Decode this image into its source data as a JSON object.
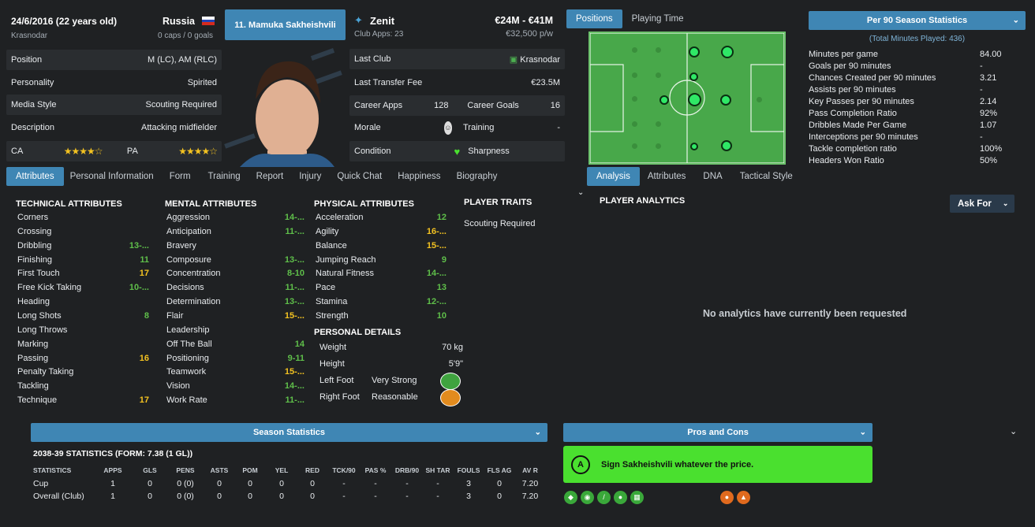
{
  "player": {
    "dob": "24/6/2016 (22 years old)",
    "club_city": "Krasnodar",
    "nation": "Russia",
    "caps": "0 caps / 0 goals",
    "name_badge": "11. Mamuka Sakheishvili",
    "club": "Zenit",
    "club_apps": "Club Apps: 23",
    "value": "€24M - €41M",
    "wage": "€32,500 p/w"
  },
  "info_rows": [
    {
      "label": "Position",
      "value": "M (LC), AM (RLC)"
    },
    {
      "label": "Personality",
      "value": "Spirited"
    },
    {
      "label": "Media Style",
      "value": "Scouting Required"
    },
    {
      "label": "Description",
      "value": "Attacking midfielder"
    }
  ],
  "ca_label": "CA",
  "pa_label": "PA",
  "ca_stars": "★★★★☆",
  "pa_stars": "★★★★☆",
  "career": {
    "last_club_label": "Last Club",
    "last_club": "Krasnodar",
    "fee_label": "Last Transfer Fee",
    "fee": "€23.5M",
    "apps_label": "Career Apps",
    "apps": "128",
    "goals_label": "Career Goals",
    "goals": "16",
    "morale_label": "Morale",
    "training_label": "Training",
    "training": "-",
    "condition_label": "Condition",
    "sharpness_label": "Sharpness"
  },
  "tabs": [
    "Attributes",
    "Personal Information",
    "Form",
    "Training",
    "Report",
    "Injury",
    "Quick Chat",
    "Happiness",
    "Biography"
  ],
  "tech_header": "TECHNICAL ATTRIBUTES",
  "mental_header": "MENTAL ATTRIBUTES",
  "physical_header": "PHYSICAL ATTRIBUTES",
  "traits_header": "PLAYER TRAITS",
  "traits_value": "Scouting Required",
  "personal_header": "PERSONAL DETAILS",
  "technical": [
    {
      "n": "Corners",
      "v": ""
    },
    {
      "n": "Crossing",
      "v": ""
    },
    {
      "n": "Dribbling",
      "v": "13-...",
      "c": "g"
    },
    {
      "n": "Finishing",
      "v": "11",
      "c": "g"
    },
    {
      "n": "First Touch",
      "v": "17",
      "c": "y"
    },
    {
      "n": "Free Kick Taking",
      "v": "10-...",
      "c": "g"
    },
    {
      "n": "Heading",
      "v": ""
    },
    {
      "n": "Long Shots",
      "v": "8",
      "c": "g"
    },
    {
      "n": "Long Throws",
      "v": ""
    },
    {
      "n": "Marking",
      "v": ""
    },
    {
      "n": "Passing",
      "v": "16",
      "c": "y"
    },
    {
      "n": "Penalty Taking",
      "v": ""
    },
    {
      "n": "Tackling",
      "v": ""
    },
    {
      "n": "Technique",
      "v": "17",
      "c": "y"
    }
  ],
  "mental": [
    {
      "n": "Aggression",
      "v": "14-...",
      "c": "g"
    },
    {
      "n": "Anticipation",
      "v": "11-...",
      "c": "g"
    },
    {
      "n": "Bravery",
      "v": ""
    },
    {
      "n": "Composure",
      "v": "13-...",
      "c": "g"
    },
    {
      "n": "Concentration",
      "v": "8-10",
      "c": "g"
    },
    {
      "n": "Decisions",
      "v": "11-...",
      "c": "g"
    },
    {
      "n": "Determination",
      "v": "13-...",
      "c": "g"
    },
    {
      "n": "Flair",
      "v": "15-...",
      "c": "y"
    },
    {
      "n": "Leadership",
      "v": ""
    },
    {
      "n": "Off The Ball",
      "v": "14",
      "c": "g"
    },
    {
      "n": "Positioning",
      "v": "9-11",
      "c": "g"
    },
    {
      "n": "Teamwork",
      "v": "15-...",
      "c": "y"
    },
    {
      "n": "Vision",
      "v": "14-...",
      "c": "g"
    },
    {
      "n": "Work Rate",
      "v": "11-...",
      "c": "g"
    }
  ],
  "physical": [
    {
      "n": "Acceleration",
      "v": "12",
      "c": "g"
    },
    {
      "n": "Agility",
      "v": "16-...",
      "c": "y"
    },
    {
      "n": "Balance",
      "v": "15-...",
      "c": "y"
    },
    {
      "n": "Jumping Reach",
      "v": "9",
      "c": "g"
    },
    {
      "n": "Natural Fitness",
      "v": "14-...",
      "c": "g"
    },
    {
      "n": "Pace",
      "v": "13",
      "c": "g"
    },
    {
      "n": "Stamina",
      "v": "12-...",
      "c": "g"
    },
    {
      "n": "Strength",
      "v": "10",
      "c": "g"
    }
  ],
  "personal": [
    {
      "n": "Weight",
      "v": "70 kg"
    },
    {
      "n": "Height",
      "v": "5'9\""
    }
  ],
  "feet": {
    "left_label": "Left Foot",
    "left": "Very Strong",
    "right_label": "Right Foot",
    "right": "Reasonable"
  },
  "pos_tabs": [
    "Positions",
    "Playing Time"
  ],
  "analysis_tabs": [
    "Analysis",
    "Attributes",
    "DNA",
    "Tactical Style"
  ],
  "analytics_title": "PLAYER ANALYTICS",
  "ask_for": "Ask For",
  "no_analytics": "No analytics have currently been requested",
  "per90": {
    "title": "Per 90 Season Statistics",
    "minutes": "(Total Minutes Played: 436)",
    "rows": [
      {
        "n": "Minutes per game",
        "v": "84.00"
      },
      {
        "n": "Goals per 90 minutes",
        "v": "-"
      },
      {
        "n": "Chances Created per 90 minutes",
        "v": "3.21"
      },
      {
        "n": "Assists per 90 minutes",
        "v": "-"
      },
      {
        "n": "Key Passes per 90 minutes",
        "v": "2.14"
      },
      {
        "n": "Pass Completion Ratio",
        "v": "92%"
      },
      {
        "n": "Dribbles Made Per Game",
        "v": "1.07"
      },
      {
        "n": "Interceptions per 90 minutes",
        "v": "-"
      },
      {
        "n": "Tackle completion ratio",
        "v": "100%"
      },
      {
        "n": "Headers Won Ratio",
        "v": "50%"
      }
    ]
  },
  "season": {
    "title": "Season Statistics",
    "subtitle": "2038-39 STATISTICS (FORM: 7.38 (1 GL))",
    "headers": [
      "STATISTICS",
      "APPS",
      "GLS",
      "PENS",
      "ASTS",
      "POM",
      "YEL",
      "RED",
      "TCK/90",
      "PAS %",
      "DRB/90",
      "SH TAR",
      "FOULS",
      "FLS AG",
      "AV R"
    ],
    "rows": [
      [
        "Cup",
        "1",
        "0",
        "0 (0)",
        "0",
        "0",
        "0",
        "0",
        "-",
        "-",
        "-",
        "-",
        "3",
        "0",
        "7.20"
      ],
      [
        "Overall (Club)",
        "1",
        "0",
        "0 (0)",
        "0",
        "0",
        "0",
        "0",
        "-",
        "-",
        "-",
        "-",
        "3",
        "0",
        "7.20"
      ]
    ]
  },
  "proscons": {
    "title": "Pros and Cons",
    "grade": "A",
    "text": "Sign Sakheishvili whatever the price."
  },
  "colors": {
    "accent": "#3f86b4",
    "green": "#5fbf4a",
    "yellow": "#f3c221",
    "pro": "#4ae02f"
  }
}
